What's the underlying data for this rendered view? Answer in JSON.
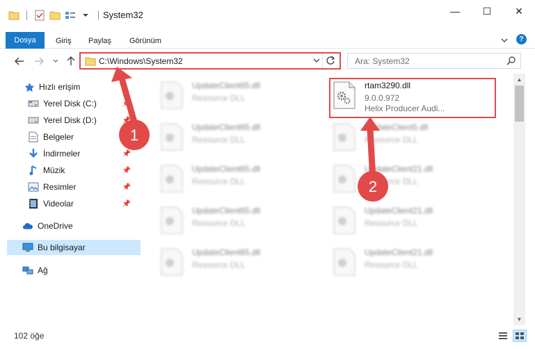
{
  "window": {
    "title": "System32",
    "minimize": "—",
    "maximize": "☐",
    "close": "✕"
  },
  "ribbon": {
    "tabs": [
      "Dosya",
      "Giriş",
      "Paylaş",
      "Görünüm"
    ],
    "help": "?"
  },
  "address": {
    "path": "C:\\Windows\\System32",
    "search_placeholder": "Ara: System32"
  },
  "sidebar": {
    "items": [
      {
        "label": "Hızlı erişim",
        "icon": "star-icon",
        "pinned": false
      },
      {
        "label": "Yerel Disk (C:)",
        "icon": "drive-icon",
        "pinned": true
      },
      {
        "label": "Yerel Disk (D:)",
        "icon": "drive-icon",
        "pinned": true
      },
      {
        "label": "Belgeler",
        "icon": "documents-icon",
        "pinned": true
      },
      {
        "label": "İndirmeler",
        "icon": "download-icon",
        "pinned": true
      },
      {
        "label": "Müzik",
        "icon": "music-icon",
        "pinned": true
      },
      {
        "label": "Resimler",
        "icon": "pictures-icon",
        "pinned": true
      },
      {
        "label": "Videolar",
        "icon": "videos-icon",
        "pinned": true
      },
      {
        "label": "OneDrive",
        "icon": "cloud-icon",
        "pinned": false
      },
      {
        "label": "Bu bilgisayar",
        "icon": "computer-icon",
        "pinned": false,
        "selected": true
      },
      {
        "label": "Ağ",
        "icon": "network-icon",
        "pinned": false
      }
    ]
  },
  "files": {
    "left_column": [
      {
        "name": "UpdateClient65.dll",
        "type": "Resource DLL"
      },
      {
        "name": "UpdateClient65.dll",
        "type": "Resource DLL"
      },
      {
        "name": "UpdateClient65.dll",
        "type": "Resource DLL"
      },
      {
        "name": "UpdateClient65.dll",
        "type": "Resource DLL"
      },
      {
        "name": "UpdateClient65.dll",
        "type": "Resource DLL"
      }
    ],
    "highlighted": {
      "name": "rtam3290.dll",
      "version": "9.0.0.972",
      "description": "Helix Producer Audi..."
    },
    "right_column": [
      {
        "name": "UpdateClient5.dll",
        "type": "Resource DLL"
      },
      {
        "name": "UpdateClient21.dll",
        "type": "Resource DLL"
      },
      {
        "name": "UpdateClient21.dll",
        "type": "Resource DLL"
      },
      {
        "name": "UpdateClient21.dll",
        "type": "Resource DLL"
      }
    ]
  },
  "status": {
    "count": "102 öğe"
  },
  "annotations": {
    "step1": "1",
    "step2": "2",
    "color": "#e24a4a"
  }
}
